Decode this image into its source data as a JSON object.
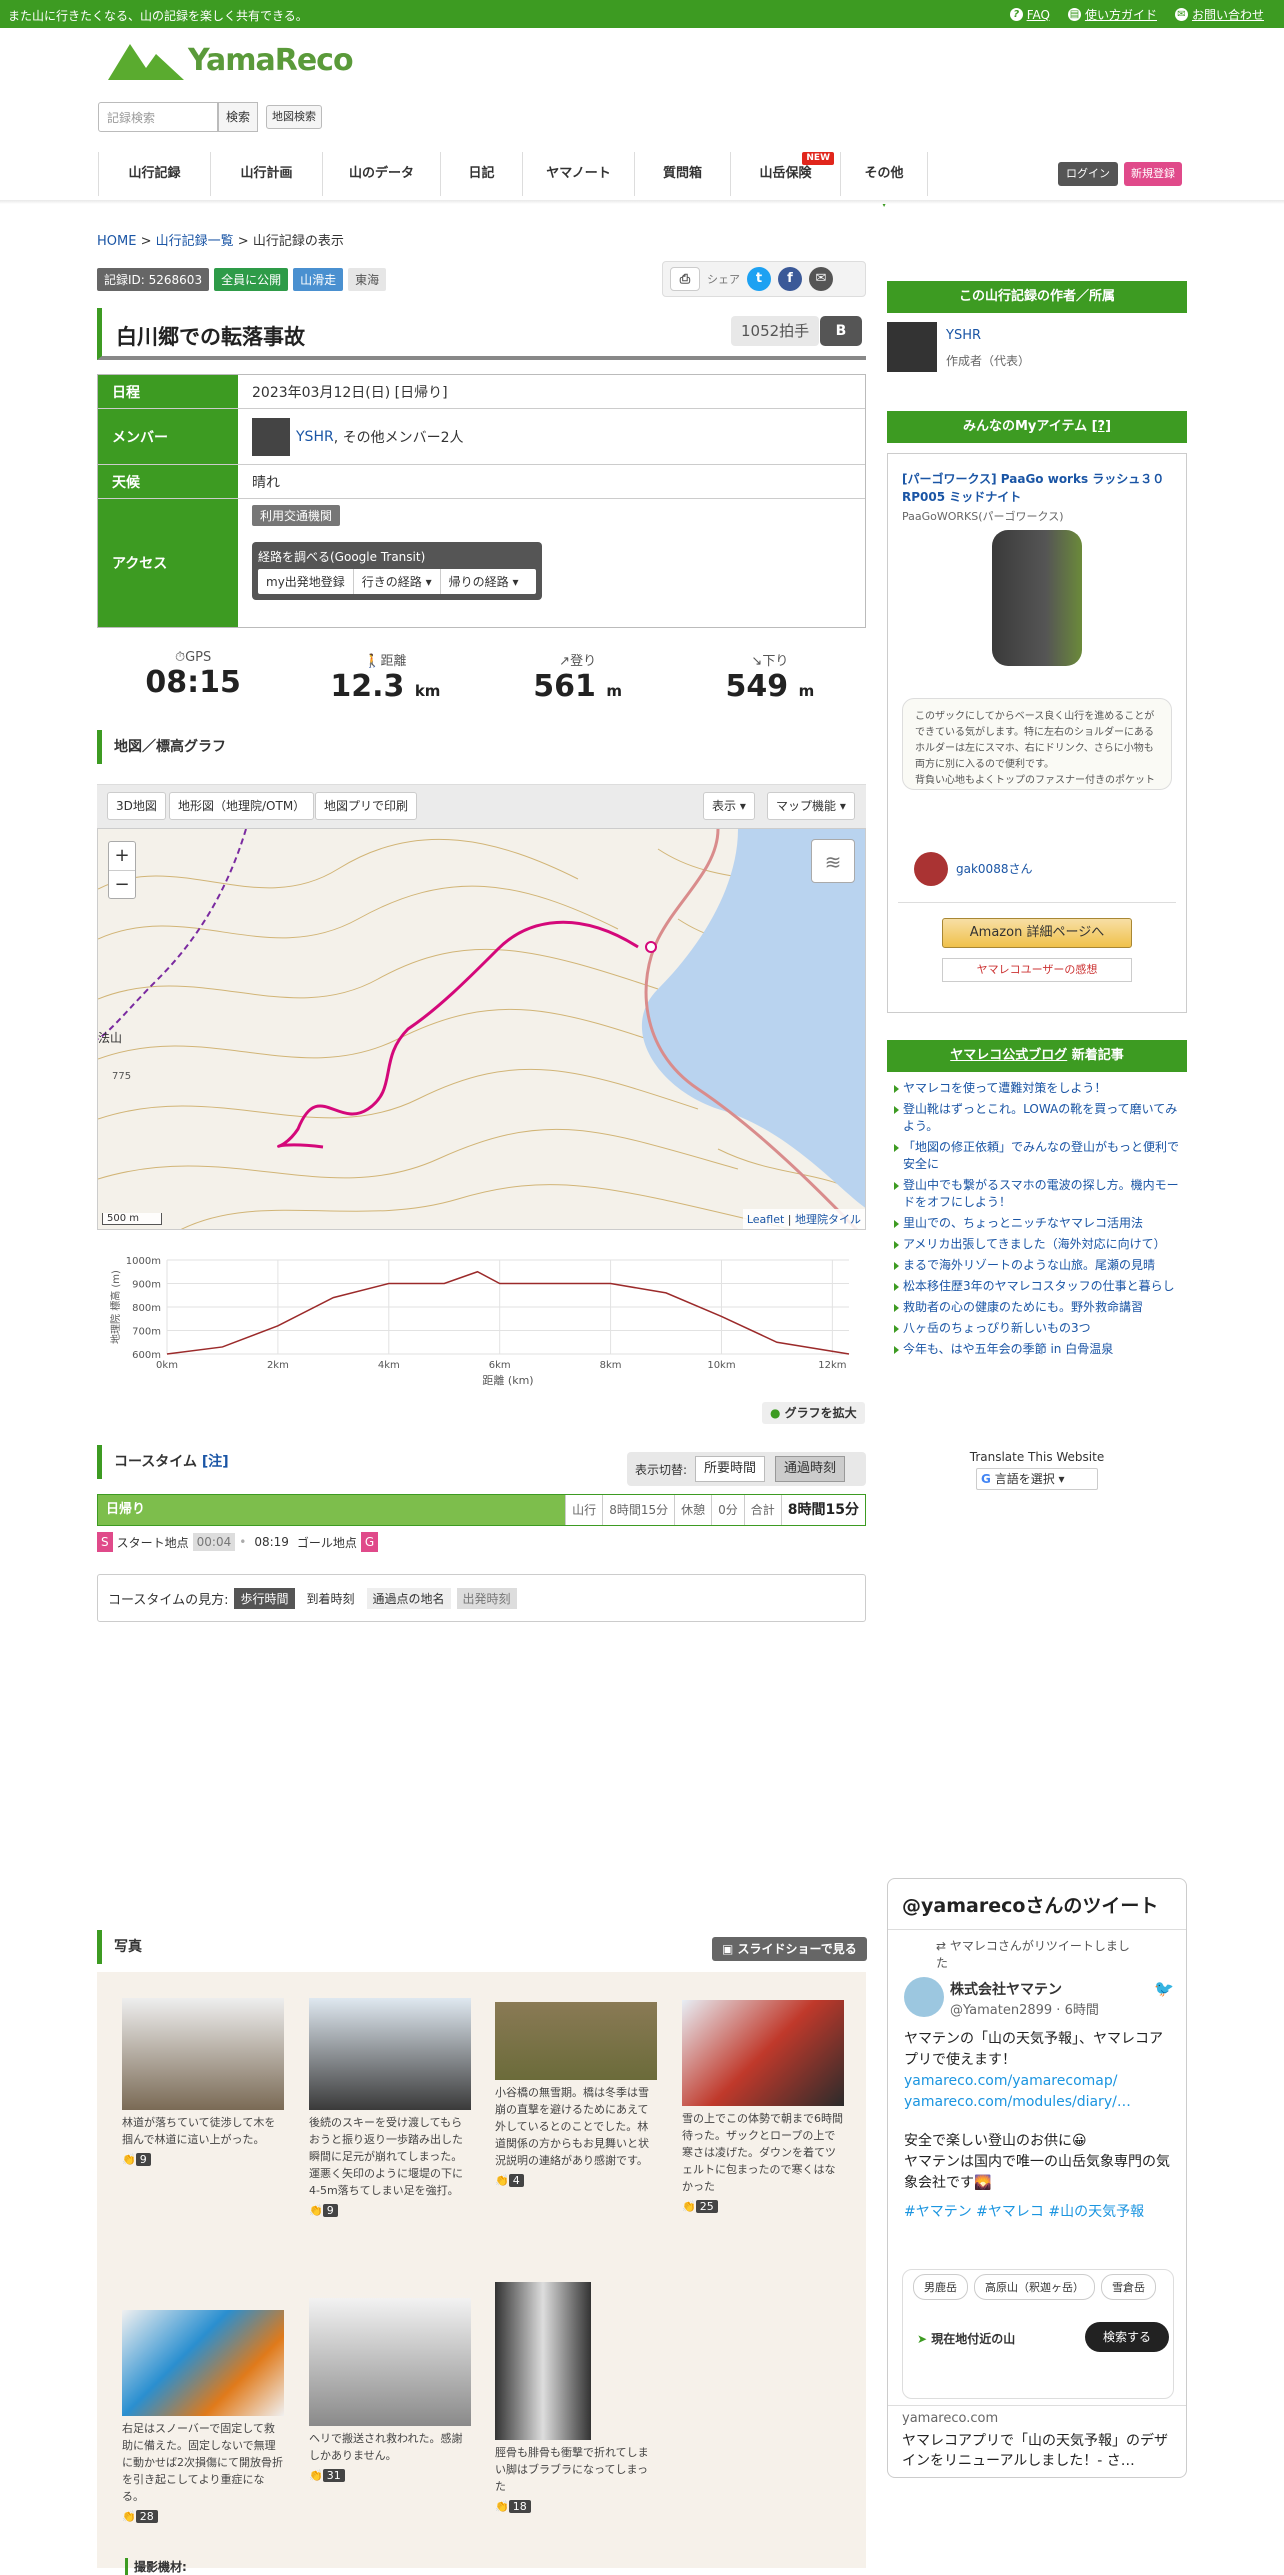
{
  "topbar": {
    "tagline": "また山に行きたくなる、山の記録を楽しく共有できる。",
    "faq": "FAQ",
    "guide": "使い方ガイド",
    "contact": "お問い合わせ"
  },
  "logo": {
    "text": "YamaReco"
  },
  "search": {
    "placeholder": "記録検索",
    "button": "検索",
    "map_button": "地図検索"
  },
  "nav": [
    "山行記録",
    "山行計画",
    "山のデータ",
    "日記",
    "ヤマノート",
    "質問箱",
    "山岳保険",
    "その他"
  ],
  "nav_new": "NEW",
  "auth": {
    "login": "ログイン",
    "register": "新規登録"
  },
  "breadcrumb": {
    "home": "HOME",
    "list": "山行記録一覧",
    "current": "山行記録の表示"
  },
  "badges": {
    "id": "記録ID: 5268603",
    "public": "全員に公開",
    "type": "山滑走",
    "area": "東海"
  },
  "share": {
    "label": "シェア"
  },
  "record": {
    "title": "白川郷での転落事故",
    "claps": "1052拍手",
    "btool": "B"
  },
  "info": {
    "date_label": "日程",
    "date": "2023年03月12日(日) [日帰り]",
    "member_label": "メンバー",
    "member_name": "YSHR",
    "member_rest": ", その他メンバー2人",
    "weather_label": "天候",
    "weather": "晴れ",
    "access_label": "アクセス",
    "transport": "利用交通機関",
    "route_title": "経路を調べる(Google Transit)",
    "route_b1": "my出発地登録",
    "route_b2": "行きの経路",
    "route_b3": "帰りの経路"
  },
  "stats": [
    {
      "label": "GPS",
      "value": "08:15",
      "unit": ""
    },
    {
      "label": "距離",
      "value": "12.3",
      "unit": "km"
    },
    {
      "label": "登り",
      "value": "561",
      "unit": "m"
    },
    {
      "label": "下り",
      "value": "549",
      "unit": "m"
    }
  ],
  "map": {
    "section": "地図／標高グラフ",
    "b3d": "3D地図",
    "btopo": "地形図（地理院/OTM）",
    "bprint": "地図プリで印刷",
    "bshow": "表示",
    "bfunc": "マップ機能",
    "scale": "500 m",
    "attrib_leaflet": "Leaflet",
    "attrib_gsi": "地理院タイル",
    "place": "法山",
    "elev": "775",
    "zoom_in": "+",
    "zoom_out": "−"
  },
  "elev_chart": {
    "ylabel": "地理院 標高 (m)",
    "xlabel": "距離 (km)",
    "yticks": [
      "1000m",
      "900m",
      "800m",
      "700m",
      "600m"
    ],
    "xticks": [
      "0km",
      "2km",
      "4km",
      "6km",
      "8km",
      "10km",
      "12km"
    ],
    "expand": "グラフを拡大"
  },
  "chart_data": {
    "type": "line",
    "x": [
      0,
      1,
      2,
      3,
      4,
      5,
      5.6,
      6,
      7,
      8,
      9,
      10,
      11,
      12.3
    ],
    "values": [
      600,
      630,
      720,
      840,
      900,
      900,
      950,
      900,
      900,
      900,
      860,
      760,
      650,
      600
    ],
    "xlabel": "距離 (km)",
    "ylabel": "地理院 標高 (m)",
    "ylim": [
      600,
      1000
    ]
  },
  "coursetime": {
    "title": "コースタイム",
    "note": "[注]",
    "switch_label": "表示切替:",
    "sw1": "所要時間",
    "sw2": "通過時刻",
    "day": "日帰り",
    "walk": "山行",
    "walk_v": "8時間15分",
    "rest": "休憩",
    "rest_v": "0分",
    "total": "合計",
    "total_v": "8時間15分",
    "s": "S",
    "start": "スタート地点",
    "t1": "00:04",
    "t2": "08:19",
    "goal": "ゴール地点",
    "g": "G",
    "howto": "コースタイムの見方:",
    "h1": "歩行時間",
    "h2": "到着時刻",
    "h3": "通過点の地名",
    "h4": "出発時刻"
  },
  "photos": {
    "section": "写真",
    "slideshow": "スライドショーで見る",
    "items": [
      {
        "caption": "林道が落ちていて徒渉して木を掴んで林道に這い上がった。",
        "likes": "9"
      },
      {
        "caption": "後続のスキーを受け渡してもらおうと振り返り一歩踏み出した瞬間に足元が崩れてしまった。\n運悪く矢印のように堰堤の下に4-5m落ちてしまい足を強打。",
        "likes": "9"
      },
      {
        "caption": "小谷橋の無雪期。橋は冬季は雪崩の直撃を避けるためにあえて外しているとのことでした。林道関係の方からもお見舞いと状況説明の連絡があり感謝です。",
        "likes": "4"
      },
      {
        "caption": "雪の上でこの体勢で朝まで6時間待った。ザックとロープの上で寒さは凌げた。ダウンを着てツェルトに包まったので寒くはなかった",
        "likes": "25"
      },
      {
        "caption": "右足はスノーバーで固定して救助に備えた。固定しないで無理に動かせば2次損傷にて開放骨折を引き起こしてより重症になる。",
        "likes": "28"
      },
      {
        "caption": "ヘリで搬送され救われた。感謝しかありません。",
        "likes": "31"
      },
      {
        "caption": "脛骨も腓骨も衝撃で折れてしまい脚はブラブラになってしまった",
        "likes": "18"
      }
    ],
    "equip": "撮影機材:"
  },
  "side": {
    "author_hd": "この山行記録の作者／所属",
    "author": "YSHR",
    "author_role": "作成者（代表）",
    "myitem_hd": "みんなのMyアイテム",
    "myitem_q": "[?]",
    "item_title": "[パーゴワークス] PaaGo works ラッシュ３０ RP005 ミッドナイト",
    "item_brand": "PaaGoWORKS(パーゴワークス)",
    "item_review": "このザックにしてからベース良く山行を進めることができている気がします。特に左右のショルダーにあるホルダーは左にスマホ、右にドリンク、さらに小物も両方に別に入るので便利です。\n背負い心地もよくトップのファスナー付きのポケットも取り出しやすいです。",
    "reviewer": "gak0088さん",
    "amazon": "Amazon 詳細ページへ",
    "user_review": "ヤマレコユーザーの感想",
    "blog_hd1": "ヤマレコ公式ブログ",
    "blog_hd2": "新着記事",
    "blog": [
      "ヤマレコを使って遭難対策をしよう！",
      "登山靴はずっとこれ。LOWAの靴を買って磨いてみよう。",
      "「地図の修正依頼」でみんなの登山がもっと便利で安全に",
      "登山中でも繋がるスマホの電波の探し方。機内モードをオフにしよう！",
      "里山での、ちょっとニッチなヤマレコ活用法",
      "アメリカ出張してきました（海外対応に向けて）",
      "まるで海外リゾートのような山旅。尾瀬の見晴",
      "松本移住歴3年のヤマレコスタッフの仕事と暮らし",
      "救助者の心の健康のためにも。野外救命講習",
      "八ヶ岳のちょっぴり新しいもの3つ",
      "今年も、はや五年会の季節 in 白骨温泉"
    ],
    "translate": "Translate This Website",
    "lang": "言語を選択"
  },
  "tweet": {
    "title": "@yamarecoさんのツイート",
    "rt": "ヤマレコさんがリツイートしました",
    "name": "株式会社ヤマテン",
    "handle": "@Yamaten2899 · 6時間",
    "body1": "ヤマテンの「山の天気予報」、ヤマレコアプリで使えます！",
    "link1": "yamareco.com/yamarecomap/",
    "link2": "yamareco.com/modules/diary/…",
    "body2": "安全で楽しい登山のお供に😀\nヤマテンは国内で唯一の山岳気象専門の気象会社です🌄",
    "tags": "#ヤマテン #ヤマレコ #山の天気予報",
    "chip1": "男鹿岳",
    "chip2": "高原山（釈迦ヶ岳）",
    "chip3": "雪倉岳",
    "nearby": "現在地付近の山",
    "searchbtn": "検索する",
    "domain": "yamareco.com",
    "foot": "ヤマレコアプリで「山の天気予報」のデザインをリニューアルしました！- さ…"
  }
}
